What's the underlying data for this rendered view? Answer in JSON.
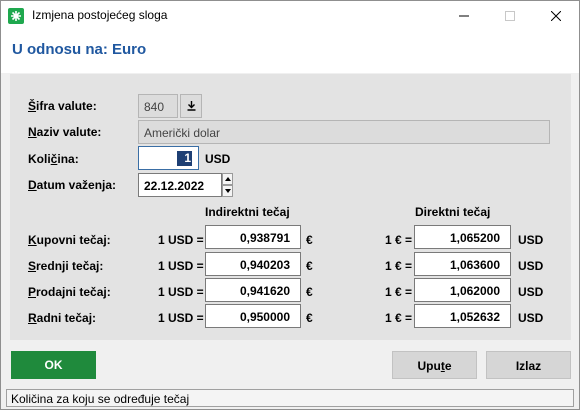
{
  "window": {
    "title": "Izmjena postojećeg sloga"
  },
  "header": {
    "title": "U odnosu na: Euro"
  },
  "form": {
    "sifra_label_prefix": "Š",
    "sifra_label_rest": "ifra valute:",
    "sifra_value": "840",
    "naziv_label_prefix": "N",
    "naziv_label_rest": "aziv valute:",
    "naziv_value": "Američki dolar",
    "kolicina_label_before": "Koli",
    "kolicina_label_underlined": "č",
    "kolicina_label_after": "ina:",
    "kolicina_value": "1",
    "kolicina_unit": "USD",
    "datum_label_prefix": "D",
    "datum_label_rest": "atum važenja:",
    "datum_value": "22.12.2022"
  },
  "rates": {
    "indirect_header": "Indirektni tečaj",
    "direct_header": "Direktni tečaj",
    "rows": [
      {
        "label_prefix": "K",
        "label_rest": "upovni tečaj:",
        "indirect_prefix": "1 USD =",
        "indirect_value": "0,938791",
        "indirect_unit": "€",
        "direct_prefix": "1 € =",
        "direct_value": "1,065200",
        "direct_unit": "USD"
      },
      {
        "label_prefix": "S",
        "label_rest": "rednji tečaj:",
        "indirect_prefix": "1 USD =",
        "indirect_value": "0,940203",
        "indirect_unit": "€",
        "direct_prefix": "1 € =",
        "direct_value": "1,063600",
        "direct_unit": "USD"
      },
      {
        "label_prefix": "P",
        "label_rest": "rodajni tečaj:",
        "indirect_prefix": "1 USD =",
        "indirect_value": "0,941620",
        "indirect_unit": "€",
        "direct_prefix": "1 € =",
        "direct_value": "1,062000",
        "direct_unit": "USD"
      },
      {
        "label_prefix": "R",
        "label_rest": "adni tečaj:",
        "indirect_prefix": "1 USD =",
        "indirect_value": "0,950000",
        "indirect_unit": "€",
        "direct_prefix": "1 € =",
        "direct_value": "1,052632",
        "direct_unit": "USD"
      }
    ]
  },
  "buttons": {
    "ok": "OK",
    "help_before": "Upu",
    "help_underlined": "t",
    "help_after": "e",
    "exit": "Izlaz"
  },
  "status": {
    "text": "Količina za koju se određuje tečaj"
  },
  "colors": {
    "accent": "#2058a0",
    "ok_button": "#1f8a3c",
    "app_icon": "#1fa84e"
  },
  "icons": {
    "app": "app-icon",
    "dropdown": "download-arrow-icon",
    "spin_up": "chevron-up-icon",
    "spin_down": "chevron-down-icon"
  }
}
